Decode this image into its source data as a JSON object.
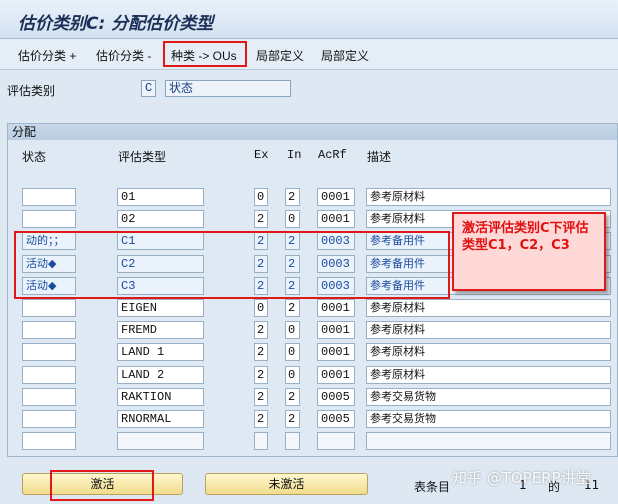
{
  "window": {
    "title": "估价类别C: 分配估价类型"
  },
  "toolbar": {
    "items": [
      {
        "label": "估价分类 +"
      },
      {
        "label": "估价分类 -"
      },
      {
        "label": "种类 -> OUs"
      },
      {
        "label": "局部定义"
      },
      {
        "label": "局部定义"
      }
    ]
  },
  "form": {
    "valuation_category_label": "评估类别",
    "valuation_category_value": "C",
    "valuation_category_desc": "状态"
  },
  "assignment": {
    "section_title": "分配",
    "columns": [
      "状态",
      "评估类型",
      "Ex",
      "In",
      "AcRf",
      "描述"
    ],
    "rows": [
      {
        "status": "",
        "type": "",
        "ex": "",
        "in": "",
        "acrf": "",
        "desc": ""
      },
      {
        "status": "",
        "type": "01",
        "ex": "0",
        "in": "2",
        "acrf": "0001",
        "desc": "参考原材料"
      },
      {
        "status": "",
        "type": "02",
        "ex": "2",
        "in": "0",
        "acrf": "0001",
        "desc": "参考原材料"
      },
      {
        "status": "动的；；",
        "type": "C1",
        "ex": "2",
        "in": "2",
        "acrf": "0003",
        "desc": "参考备用件"
      },
      {
        "status": "活动◆",
        "type": "C2",
        "ex": "2",
        "in": "2",
        "acrf": "0003",
        "desc": "参考备用件"
      },
      {
        "status": "活动◆",
        "type": "C3",
        "ex": "2",
        "in": "2",
        "acrf": "0003",
        "desc": "参考备用件"
      },
      {
        "status": "",
        "type": "EIGEN",
        "ex": "0",
        "in": "2",
        "acrf": "0001",
        "desc": "参考原材料"
      },
      {
        "status": "",
        "type": "FREMD",
        "ex": "2",
        "in": "0",
        "acrf": "0001",
        "desc": "参考原材料"
      },
      {
        "status": "",
        "type": "LAND 1",
        "ex": "2",
        "in": "0",
        "acrf": "0001",
        "desc": "参考原材料"
      },
      {
        "status": "",
        "type": "LAND 2",
        "ex": "2",
        "in": "0",
        "acrf": "0001",
        "desc": "参考原材料"
      },
      {
        "status": "",
        "type": "RAKTION",
        "ex": "2",
        "in": "2",
        "acrf": "0005",
        "desc": "参考交易货物"
      },
      {
        "status": "",
        "type": "RNORMAL",
        "ex": "2",
        "in": "2",
        "acrf": "0005",
        "desc": "参考交易货物"
      },
      {
        "status": "",
        "type": "",
        "ex": "",
        "in": "",
        "acrf": "",
        "desc": ""
      }
    ]
  },
  "annotation": {
    "text": "激活评估类别C下评估类型C1，C2，C3"
  },
  "buttons": {
    "activate": "激活",
    "deactivate": "未激活"
  },
  "footer": {
    "entries_label": "表条目",
    "page_current": "1",
    "page_of": "的",
    "page_total": "11"
  },
  "watermark": {
    "text": "知乎 @TOPERP讲堂"
  },
  "colors": {
    "highlight_red": "#e01818",
    "title_blue": "#1c2f57",
    "active_text_blue": "#1a4ba0",
    "button_yellow": "#f1dc8b"
  }
}
